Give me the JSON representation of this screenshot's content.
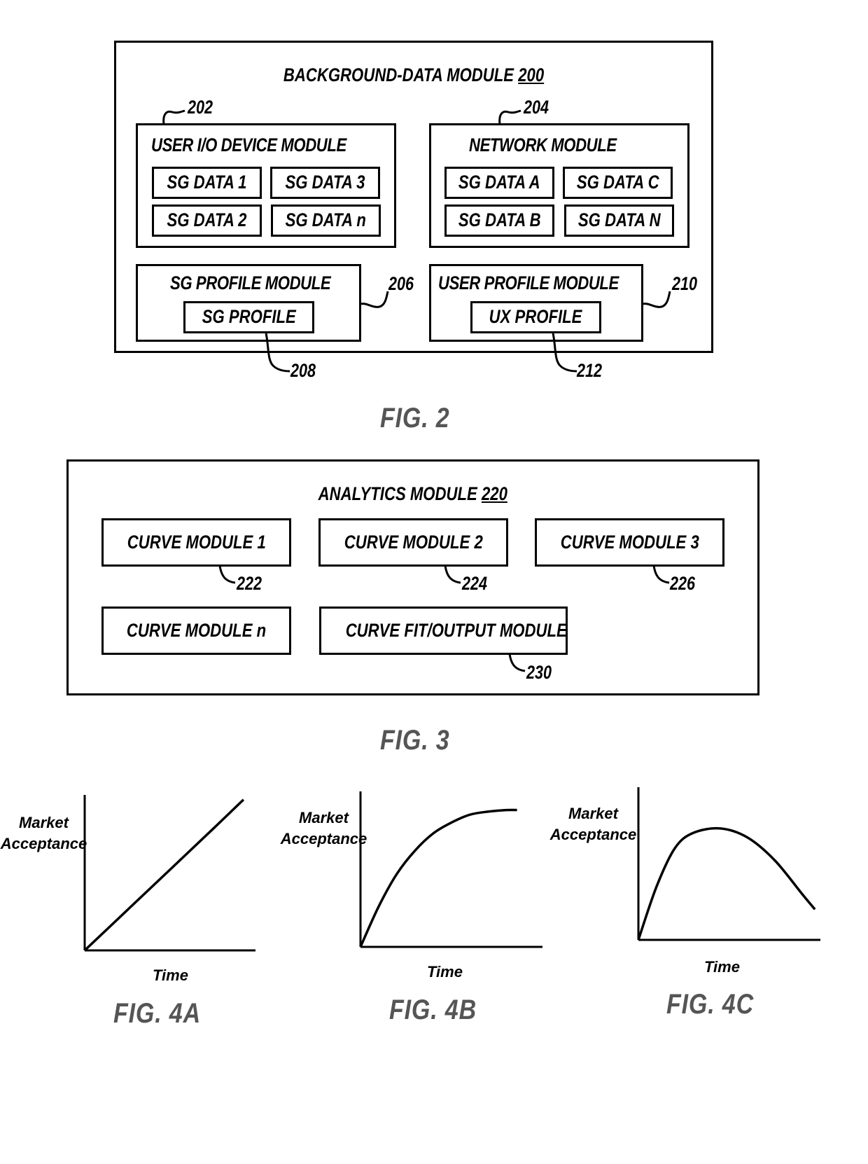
{
  "fig2": {
    "title_text": "BACKGROUND-DATA MODULE ",
    "title_ref": "200",
    "user_io": {
      "ref": "202",
      "label": "USER I/O DEVICE MODULE",
      "items": [
        "SG DATA 1",
        "SG DATA 3",
        "SG DATA 2",
        "SG DATA n"
      ]
    },
    "network": {
      "ref": "204",
      "label": "NETWORK MODULE",
      "items": [
        "SG DATA A",
        "SG DATA C",
        "SG DATA B",
        "SG DATA N"
      ]
    },
    "sg_profile_module": {
      "ref": "206",
      "label": "SG PROFILE MODULE",
      "inner_label": "SG PROFILE",
      "inner_ref": "208"
    },
    "user_profile_module": {
      "ref": "210",
      "label": "USER PROFILE MODULE",
      "inner_label": "UX PROFILE",
      "inner_ref": "212"
    },
    "caption": "FIG. 2"
  },
  "fig3": {
    "title_text": "ANALYTICS MODULE ",
    "title_ref": "220",
    "modules": [
      {
        "label": "CURVE MODULE 1",
        "ref": "222"
      },
      {
        "label": "CURVE MODULE 2",
        "ref": "224"
      },
      {
        "label": "CURVE MODULE 3",
        "ref": "226"
      },
      {
        "label": "CURVE MODULE n",
        "ref": ""
      },
      {
        "label": "CURVE FIT/OUTPUT MODULE",
        "ref": "230"
      }
    ],
    "caption": "FIG. 3"
  },
  "chart_data": [
    {
      "type": "line",
      "title": "FIG. 4A",
      "xlabel": "Time",
      "ylabel_line1": "Market",
      "ylabel_line2": "Acceptance",
      "shape": "linear increase",
      "x": [
        0,
        0.25,
        0.5,
        0.75,
        0.93
      ],
      "y": [
        0,
        0.26,
        0.52,
        0.78,
        0.97
      ],
      "xlim": [
        0,
        1
      ],
      "ylim": [
        0,
        1
      ],
      "grid": false
    },
    {
      "type": "line",
      "title": "FIG. 4B",
      "xlabel": "Time",
      "ylabel_line1": "Market",
      "ylabel_line2": "Acceptance",
      "shape": "saturating growth",
      "x": [
        0,
        0.1,
        0.2,
        0.3,
        0.4,
        0.5,
        0.6,
        0.7,
        0.8,
        0.86
      ],
      "y": [
        0,
        0.26,
        0.47,
        0.62,
        0.73,
        0.8,
        0.85,
        0.87,
        0.88,
        0.88
      ],
      "xlim": [
        0,
        1
      ],
      "ylim": [
        0,
        1
      ],
      "grid": false
    },
    {
      "type": "line",
      "title": "FIG. 4C",
      "xlabel": "Time",
      "ylabel_line1": "Market",
      "ylabel_line2": "Acceptance",
      "shape": "rise then decline",
      "x": [
        0,
        0.1,
        0.2,
        0.3,
        0.45,
        0.6,
        0.75,
        0.9,
        0.97
      ],
      "y": [
        0,
        0.35,
        0.6,
        0.7,
        0.73,
        0.67,
        0.52,
        0.3,
        0.2
      ],
      "xlim": [
        0,
        1
      ],
      "ylim": [
        0,
        1
      ],
      "grid": false
    }
  ]
}
